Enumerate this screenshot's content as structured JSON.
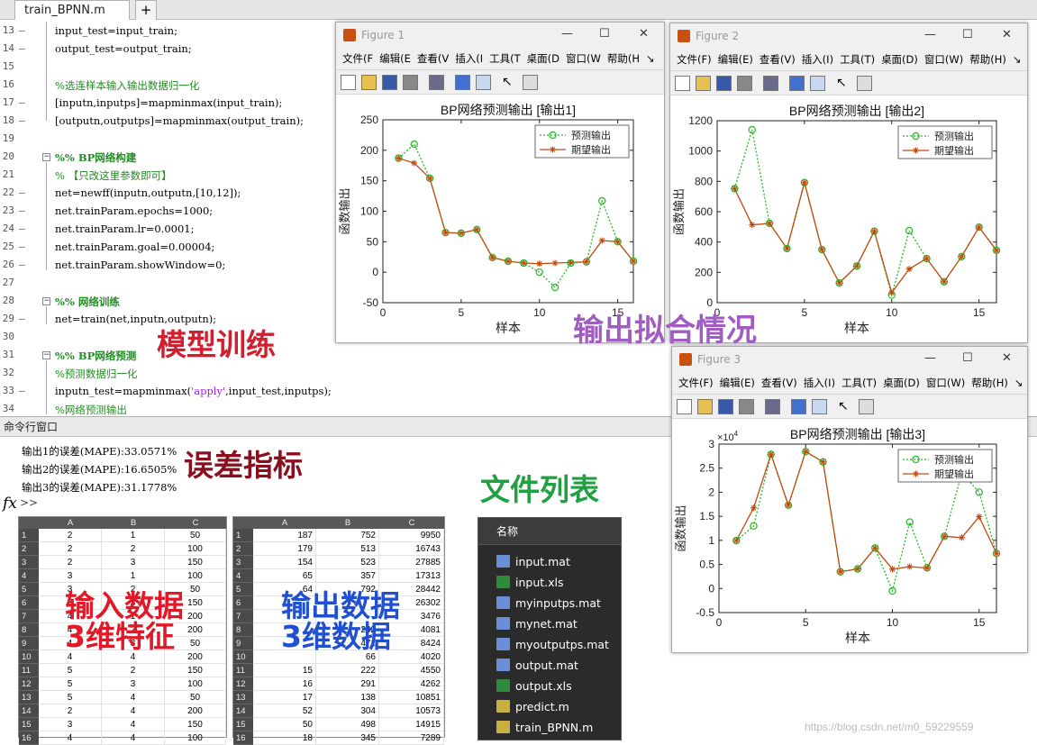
{
  "editor": {
    "tab_label": "train_BPNN.m",
    "tab_close": "×",
    "tab_add": "+",
    "lines": [
      {
        "num": "13",
        "dash": "–",
        "text": "input_test=input_train;",
        "kind": "code"
      },
      {
        "num": "14",
        "dash": "–",
        "text": "output_test=output_train;",
        "kind": "code"
      },
      {
        "num": "15",
        "dash": "",
        "text": "",
        "kind": "code"
      },
      {
        "num": "16",
        "dash": "",
        "text": "%选连样本输入输出数据归一化",
        "kind": "cm"
      },
      {
        "num": "17",
        "dash": "–",
        "text": "[inputn,inputps]=mapminmax(input_train);",
        "kind": "code"
      },
      {
        "num": "18",
        "dash": "–",
        "text": "[outputn,outputps]=mapminmax(output_train);",
        "kind": "code"
      },
      {
        "num": "19",
        "dash": "",
        "text": "",
        "kind": "code"
      },
      {
        "num": "20",
        "dash": "",
        "text": "%% BP网络构建",
        "kind": "sec"
      },
      {
        "num": "21",
        "dash": "",
        "text": "% 【只改这里参数即可】",
        "kind": "cm"
      },
      {
        "num": "22",
        "dash": "–",
        "text": "net=newff(inputn,outputn,[10,12]);",
        "kind": "code"
      },
      {
        "num": "23",
        "dash": "–",
        "text": "net.trainParam.epochs=1000;",
        "kind": "code"
      },
      {
        "num": "24",
        "dash": "–",
        "text": "net.trainParam.lr=0.0001;",
        "kind": "code"
      },
      {
        "num": "25",
        "dash": "–",
        "text": "net.trainParam.goal=0.00004;",
        "kind": "code"
      },
      {
        "num": "26",
        "dash": "–",
        "text": "net.trainParam.showWindow=0;",
        "kind": "code"
      },
      {
        "num": "27",
        "dash": "",
        "text": "",
        "kind": "code"
      },
      {
        "num": "28",
        "dash": "",
        "text": "%% 网络训练",
        "kind": "sec"
      },
      {
        "num": "29",
        "dash": "–",
        "text": "net=train(net,inputn,outputn);",
        "kind": "code"
      },
      {
        "num": "30",
        "dash": "",
        "text": "",
        "kind": "code"
      },
      {
        "num": "31",
        "dash": "",
        "text": "%% BP网络预测",
        "kind": "sec"
      },
      {
        "num": "32",
        "dash": "",
        "text": "%预测数据归一化",
        "kind": "cm"
      },
      {
        "num": "33",
        "dash": "–",
        "text": "inputn_test=mapminmax('apply',input_test,inputps);",
        "kind": "code"
      },
      {
        "num": "34",
        "dash": "",
        "text": "%网络预测输出",
        "kind": "cm"
      }
    ]
  },
  "command_window": {
    "title": "命令行窗口",
    "lines": [
      "输出1的误差(MAPE):33.0571%",
      "输出2的误差(MAPE):16.6505%",
      "输出3的误差(MAPE):31.1778%"
    ],
    "fx": "fx",
    "prompt": ">>"
  },
  "annotations": {
    "model_training": "模型训练",
    "output_fit": "输出拟合情况",
    "error_metric": "误差指标",
    "file_list": "文件列表",
    "input_data": "输入数据\n3维特征",
    "output_data": "输出数据\n3维数据"
  },
  "input_table": {
    "headers": [
      "A",
      "B",
      "C"
    ],
    "row_numbers": [
      "1",
      "2",
      "3",
      "4",
      "5",
      "6",
      "7",
      "8",
      "9",
      "10",
      "11",
      "12",
      "13",
      "14",
      "15",
      "16"
    ],
    "rows": [
      [
        "2",
        "1",
        "50"
      ],
      [
        "2",
        "2",
        "100"
      ],
      [
        "2",
        "3",
        "150"
      ],
      [
        "3",
        "1",
        "100"
      ],
      [
        "3",
        "2",
        "50"
      ],
      [
        "3",
        "3",
        "150"
      ],
      [
        "4",
        "1",
        "200"
      ],
      [
        "4",
        "2",
        "200"
      ],
      [
        "4",
        "3",
        "50"
      ],
      [
        "4",
        "4",
        "200"
      ],
      [
        "5",
        "2",
        "150"
      ],
      [
        "5",
        "3",
        "100"
      ],
      [
        "5",
        "4",
        "50"
      ],
      [
        "2",
        "4",
        "200"
      ],
      [
        "3",
        "4",
        "150"
      ],
      [
        "4",
        "4",
        "100"
      ]
    ]
  },
  "output_table": {
    "headers": [
      "A",
      "B",
      "C"
    ],
    "row_numbers": [
      "1",
      "2",
      "3",
      "4",
      "5",
      "6",
      "7",
      "8",
      "9",
      "10",
      "11",
      "12",
      "13",
      "14",
      "15",
      "16"
    ],
    "rows": [
      [
        "187",
        "752",
        "9950"
      ],
      [
        "179",
        "513",
        "16743"
      ],
      [
        "154",
        "523",
        "27885"
      ],
      [
        "65",
        "357",
        "17313"
      ],
      [
        "64",
        "792",
        "28442"
      ],
      [
        "",
        "",
        "26302"
      ],
      [
        "",
        "",
        "3476"
      ],
      [
        "",
        "242",
        "4081"
      ],
      [
        "",
        "471",
        "8424"
      ],
      [
        "",
        "66",
        "4020"
      ],
      [
        "15",
        "222",
        "4550"
      ],
      [
        "16",
        "291",
        "4262"
      ],
      [
        "17",
        "138",
        "10851"
      ],
      [
        "52",
        "304",
        "10573"
      ],
      [
        "50",
        "498",
        "14915"
      ],
      [
        "18",
        "345",
        "7289"
      ]
    ]
  },
  "file_browser": {
    "header": "名称",
    "files": [
      {
        "name": "input.mat",
        "icon": "mat-file-icon",
        "color": "#6a8fd8"
      },
      {
        "name": "input.xls",
        "icon": "excel-file-icon",
        "color": "#2e8b3d"
      },
      {
        "name": "myinputps.mat",
        "icon": "mat-file-icon",
        "color": "#6a8fd8"
      },
      {
        "name": "mynet.mat",
        "icon": "mat-file-icon",
        "color": "#6a8fd8"
      },
      {
        "name": "myoutputps.mat",
        "icon": "mat-file-icon",
        "color": "#6a8fd8"
      },
      {
        "name": "output.mat",
        "icon": "mat-file-icon",
        "color": "#6a8fd8"
      },
      {
        "name": "output.xls",
        "icon": "excel-file-icon",
        "color": "#2e8b3d"
      },
      {
        "name": "predict.m",
        "icon": "m-file-icon",
        "color": "#c8b040"
      },
      {
        "name": "train_BPNN.m",
        "icon": "m-file-icon",
        "color": "#c8b040"
      }
    ]
  },
  "figures": [
    {
      "title": "Figure 1",
      "menu": [
        "文件(F",
        "编辑(E",
        "查看(V",
        "插入(I",
        "工具(T",
        "桌面(D",
        "窗口(W",
        "帮助(H",
        "↘"
      ]
    },
    {
      "title": "Figure 2",
      "menu": [
        "文件(F)",
        "编辑(E)",
        "查看(V)",
        "插入(I)",
        "工具(T)",
        "桌面(D)",
        "窗口(W)",
        "帮助(H)",
        "↘"
      ]
    },
    {
      "title": "Figure 3",
      "menu": [
        "文件(F)",
        "编辑(E)",
        "查看(V)",
        "插入(I)",
        "工具(T)",
        "桌面(D)",
        "窗口(W)",
        "帮助(H)",
        "↘"
      ]
    }
  ],
  "window_buttons": {
    "minimize": "—",
    "maximize": "☐",
    "close": "✕"
  },
  "chart_data": [
    {
      "type": "line",
      "title": "BP网络预测输出 [输出1]",
      "xlabel": "样本",
      "ylabel": "函数输出",
      "xlim": [
        0,
        16
      ],
      "ylim": [
        -50,
        250
      ],
      "xticks": [
        0,
        5,
        10,
        15
      ],
      "yticks": [
        -50,
        0,
        50,
        100,
        150,
        200,
        250
      ],
      "y_exponent": "",
      "legend_position": "top-right",
      "series": [
        {
          "name": "预测输出",
          "style": "dotted",
          "marker": "circle",
          "color": "#22bb22",
          "x": [
            1,
            2,
            3,
            4,
            5,
            6,
            7,
            8,
            9,
            10,
            11,
            12,
            13,
            14,
            15,
            16
          ],
          "values": [
            187,
            210,
            154,
            65,
            64,
            70,
            24,
            18,
            15,
            0,
            -25,
            15,
            17,
            117,
            50,
            18
          ]
        },
        {
          "name": "期望输出",
          "style": "solid",
          "marker": "star",
          "color": "#c04a10",
          "x": [
            1,
            2,
            3,
            4,
            5,
            6,
            7,
            8,
            9,
            10,
            11,
            12,
            13,
            14,
            15,
            16
          ],
          "values": [
            187,
            179,
            154,
            65,
            64,
            70,
            24,
            18,
            15,
            14,
            15,
            16,
            17,
            52,
            50,
            18
          ]
        }
      ]
    },
    {
      "type": "line",
      "title": "BP网络预测输出 [输出2]",
      "xlabel": "样本",
      "ylabel": "函数输出",
      "xlim": [
        0,
        16
      ],
      "ylim": [
        0,
        1200
      ],
      "xticks": [
        0,
        5,
        10,
        15
      ],
      "yticks": [
        0,
        200,
        400,
        600,
        800,
        1000,
        1200
      ],
      "y_exponent": "",
      "legend_position": "top-right",
      "series": [
        {
          "name": "预测输出",
          "style": "dotted",
          "marker": "circle",
          "color": "#22bb22",
          "x": [
            1,
            2,
            3,
            4,
            5,
            6,
            7,
            8,
            9,
            10,
            11,
            12,
            13,
            14,
            15,
            16
          ],
          "values": [
            752,
            1140,
            523,
            357,
            792,
            350,
            130,
            242,
            471,
            50,
            475,
            291,
            138,
            304,
            498,
            345
          ]
        },
        {
          "name": "期望输出",
          "style": "solid",
          "marker": "star",
          "color": "#c04a10",
          "x": [
            1,
            2,
            3,
            4,
            5,
            6,
            7,
            8,
            9,
            10,
            11,
            12,
            13,
            14,
            15,
            16
          ],
          "values": [
            752,
            513,
            523,
            357,
            792,
            350,
            130,
            242,
            471,
            66,
            222,
            291,
            138,
            304,
            498,
            345
          ]
        }
      ]
    },
    {
      "type": "line",
      "title": "BP网络预测输出 [输出3]",
      "xlabel": "样本",
      "ylabel": "函数输出",
      "xlim": [
        0,
        16
      ],
      "ylim": [
        -0.5,
        3
      ],
      "xticks": [
        0,
        5,
        10,
        15
      ],
      "yticks": [
        -0.5,
        0,
        0.5,
        1,
        1.5,
        2,
        2.5,
        3
      ],
      "y_exponent": "×10",
      "y_exponent_power": "4",
      "legend_position": "top-right",
      "series": [
        {
          "name": "预测输出",
          "style": "dotted",
          "marker": "circle",
          "color": "#22bb22",
          "x": [
            1,
            2,
            3,
            4,
            5,
            6,
            7,
            8,
            9,
            10,
            11,
            12,
            13,
            14,
            15,
            16
          ],
          "values": [
            0.995,
            1.3,
            2.7885,
            1.7313,
            2.8442,
            2.6302,
            0.3476,
            0.4081,
            0.8424,
            -0.05,
            1.38,
            0.43,
            1.0851,
            2.4,
            2.0,
            0.7289
          ]
        },
        {
          "name": "期望输出",
          "style": "solid",
          "marker": "star",
          "color": "#c04a10",
          "x": [
            1,
            2,
            3,
            4,
            5,
            6,
            7,
            8,
            9,
            10,
            11,
            12,
            13,
            14,
            15,
            16
          ],
          "values": [
            0.995,
            1.6743,
            2.7885,
            1.7313,
            2.8442,
            2.6302,
            0.3476,
            0.4081,
            0.8424,
            0.402,
            0.455,
            0.4262,
            1.0851,
            1.0573,
            1.4915,
            0.7289
          ]
        }
      ]
    }
  ],
  "watermark": "https://blog.csdn.net/m0_59229559"
}
